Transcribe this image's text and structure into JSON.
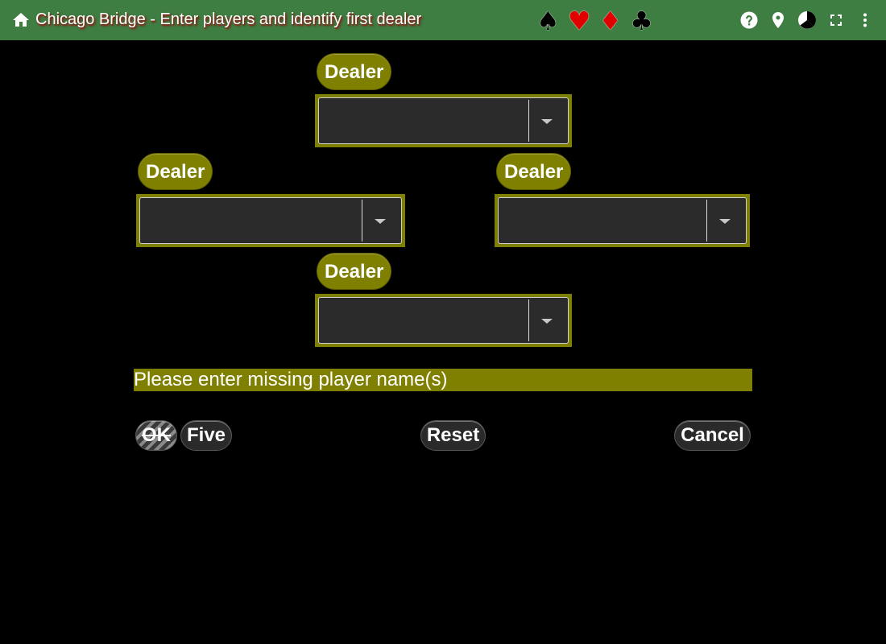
{
  "header": {
    "title": "Chicago Bridge - Enter players and identify first dealer",
    "home_icon": "home-icon",
    "suits": [
      "♠",
      "♥",
      "♦",
      "♣"
    ],
    "suit_colors": {
      "spade": "#000000",
      "heart": "#e00000",
      "diamond": "#e00000",
      "club": "#000000"
    },
    "actions": [
      "help-icon",
      "location-pin-icon",
      "pie-chart-icon",
      "fullscreen-icon",
      "more-vert-icon"
    ],
    "background": "#3f7e42"
  },
  "seats": {
    "north": {
      "dealer_label": "Dealer",
      "player": ""
    },
    "west": {
      "dealer_label": "Dealer",
      "player": ""
    },
    "east": {
      "dealer_label": "Dealer",
      "player": ""
    },
    "south": {
      "dealer_label": "Dealer",
      "player": ""
    }
  },
  "message": "Please enter missing player name(s)",
  "buttons": {
    "ok": "OK",
    "five": "Five",
    "reset": "Reset",
    "cancel": "Cancel"
  },
  "colors": {
    "accent": "#808000",
    "background": "#000000",
    "select_background": "#2b2b2b"
  }
}
